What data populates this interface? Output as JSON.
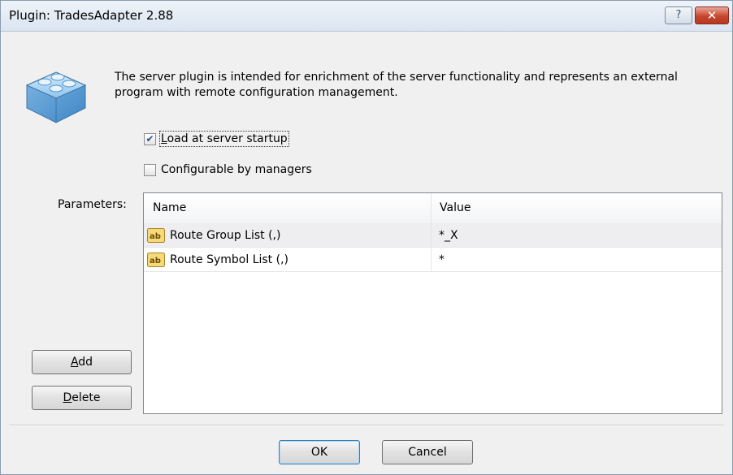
{
  "window": {
    "title": "Plugin: TradesAdapter 2.88",
    "help_label": "?",
    "close_label": "✕"
  },
  "description": "The server plugin is intended for enrichment of the server functionality and represents an external program with remote configuration management.",
  "options": {
    "load_at_startup": {
      "accel": "L",
      "rest": "oad at server startup",
      "checked": true
    },
    "configurable_by_managers": {
      "label": "Configurable by managers",
      "checked": false
    }
  },
  "parameters": {
    "label": "Parameters:",
    "columns": [
      "Name",
      "Value"
    ],
    "rows": [
      {
        "name": "Route Group List (,)",
        "value": "*_X",
        "icon": "ab-text-icon",
        "selected": true
      },
      {
        "name": "Route Symbol List (,)",
        "value": "*",
        "icon": "ab-text-icon",
        "selected": false
      }
    ]
  },
  "buttons": {
    "add": {
      "accel": "A",
      "rest": "dd"
    },
    "delete": {
      "accel": "D",
      "rest": "elete"
    },
    "ok": "OK",
    "cancel": "Cancel"
  },
  "colors": {
    "checkmark": "#2a4d8f",
    "selected_row": "#eeeef0",
    "close_button": "#c7452c"
  }
}
